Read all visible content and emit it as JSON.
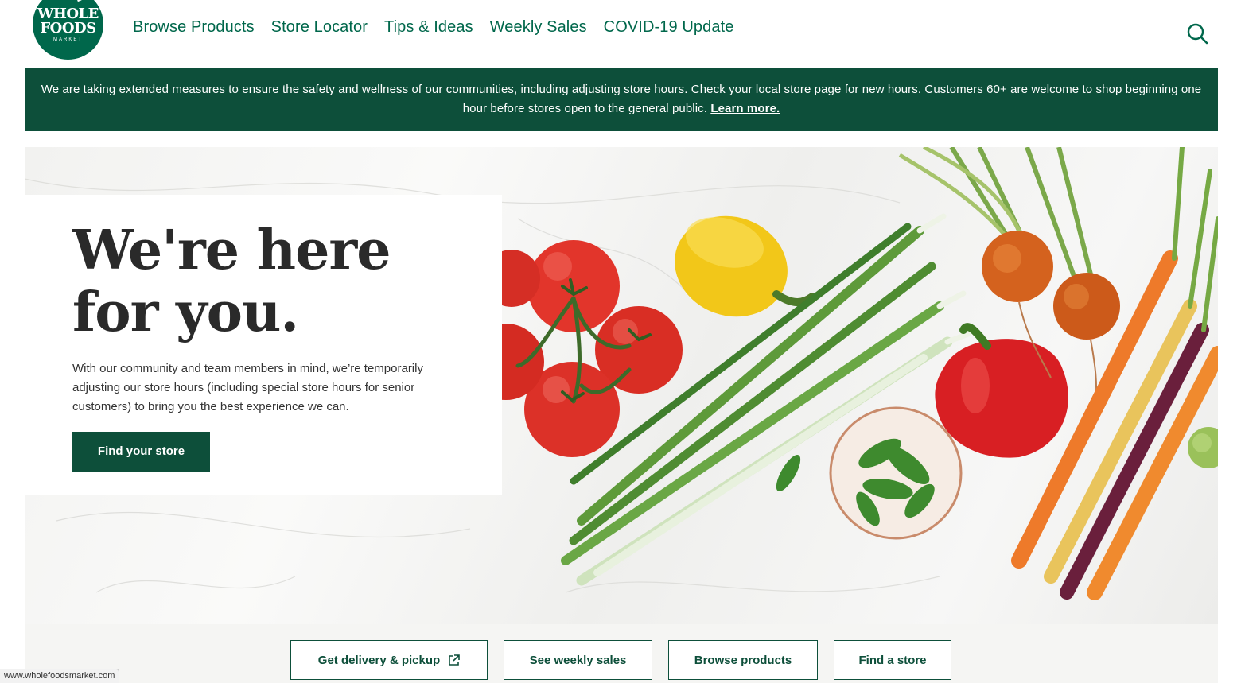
{
  "logo": {
    "line1": "WHOLE",
    "line2": "FOODS",
    "line3": "MARKET"
  },
  "nav": [
    {
      "label": "Browse Products"
    },
    {
      "label": "Store Locator"
    },
    {
      "label": "Tips & Ideas"
    },
    {
      "label": "Weekly Sales"
    },
    {
      "label": "COVID-19 Update"
    }
  ],
  "search_icon": "search-icon",
  "banner": {
    "text": "We are taking extended measures to ensure the safety and wellness of our communities, including adjusting store hours. Check your local store page for new hours. Customers 60+ are welcome to shop beginning one hour before stores open to the general public.",
    "link": "Learn more."
  },
  "hero": {
    "heading": "We're here for you.",
    "body": "With our community and team members in mind, we’re temporarily adjusting our store hours (including special store hours for senior customers) to bring you the best experience we can.",
    "cta": "Find your store"
  },
  "quick_links": [
    {
      "label": "Get delivery & pickup",
      "icon": "external-link-icon"
    },
    {
      "label": "See weekly sales"
    },
    {
      "label": "Browse products"
    },
    {
      "label": "Find a store"
    }
  ],
  "status_bar": {
    "url": "www.wholefoodsmarket.com"
  },
  "colors": {
    "brand_green": "#00674b",
    "dark_green": "#0d4f3a"
  }
}
